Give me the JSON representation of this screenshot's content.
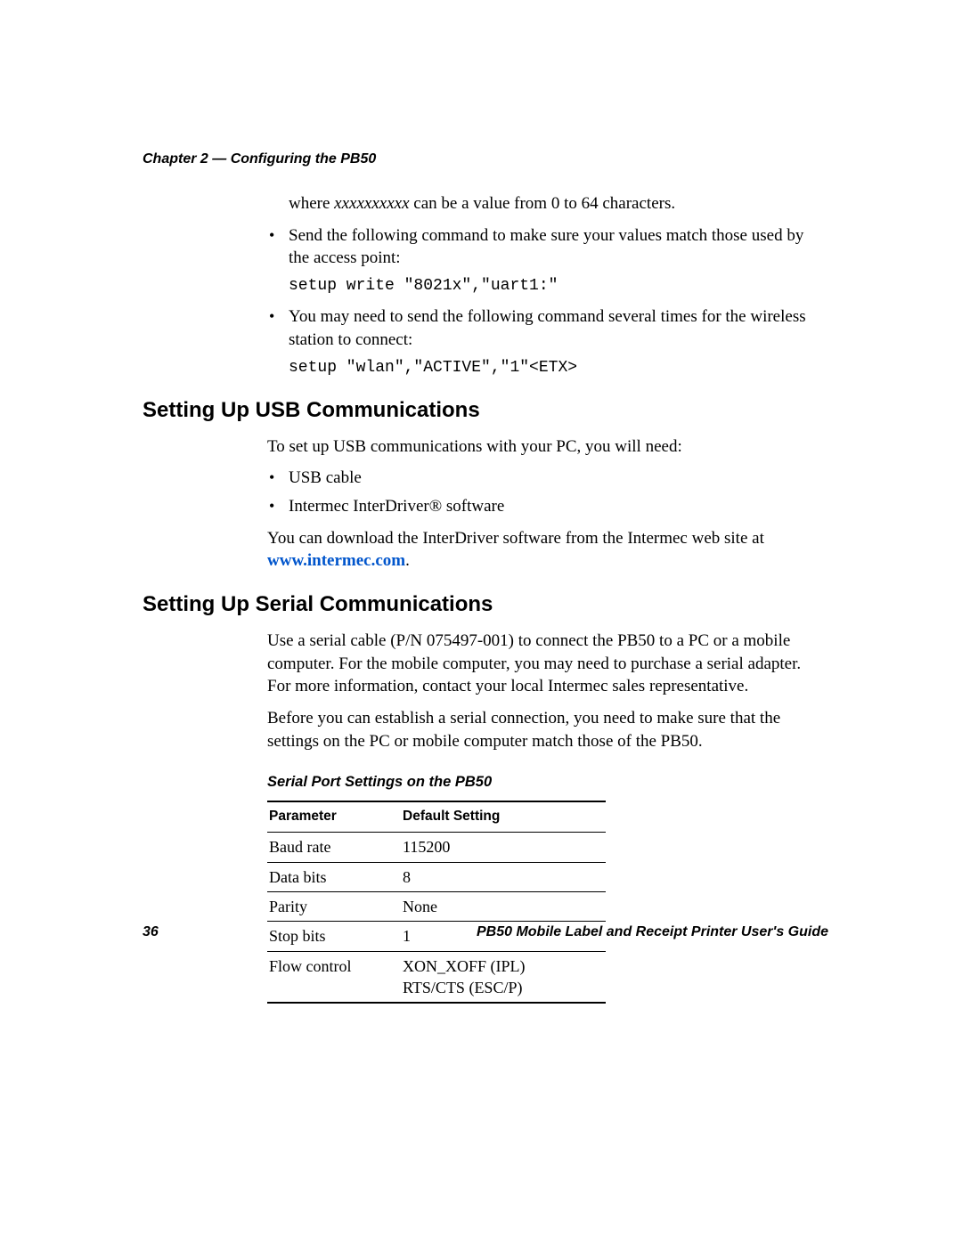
{
  "header": {
    "running": "Chapter 2 — Configuring the PB50"
  },
  "intro": {
    "where_prefix": "where ",
    "where_var": "xxxxxxxxxx",
    "where_suffix": " can be a value from 0 to 64 characters.",
    "bullet_send": "Send the following command to make sure your values match those used by the access point:",
    "code_send": "setup write \"8021x\",\"uart1:\"",
    "bullet_repeat": "You may need to send the following command several times for the wireless station to connect:",
    "code_repeat": "setup \"wlan\",\"ACTIVE\",\"1\"<ETX>"
  },
  "usb": {
    "heading": "Setting Up USB Communications",
    "intro": "To set up USB communications with your PC, you will need:",
    "item1": "USB cable",
    "item2": "Intermec InterDriver® software",
    "download_prefix": "You can download the InterDriver software from the Intermec web site at ",
    "download_link": "www.intermec.com",
    "download_suffix": "."
  },
  "serial": {
    "heading": "Setting Up Serial Communications",
    "para1": "Use a serial cable (P/N 075497-001) to connect the PB50 to a PC or a mobile computer. For the mobile computer, you may need to purchase a serial adapter. For more information, contact your local Intermec sales representative.",
    "para2": "Before you can establish a serial connection, you need to make sure that the settings on the PC or mobile computer match those of the PB50.",
    "table_caption": "Serial Port Settings on the PB50",
    "table": {
      "col1": "Parameter",
      "col2": "Default Setting",
      "rows": [
        {
          "p": "Baud rate",
          "v": "115200"
        },
        {
          "p": "Data bits",
          "v": "8"
        },
        {
          "p": "Parity",
          "v": "None"
        },
        {
          "p": "Stop bits",
          "v": "1"
        },
        {
          "p": "Flow control",
          "v": "XON_XOFF (IPL)\nRTS/CTS (ESC/P)"
        }
      ]
    }
  },
  "footer": {
    "page": "36",
    "title": "PB50 Mobile Label and Receipt Printer User's Guide"
  }
}
